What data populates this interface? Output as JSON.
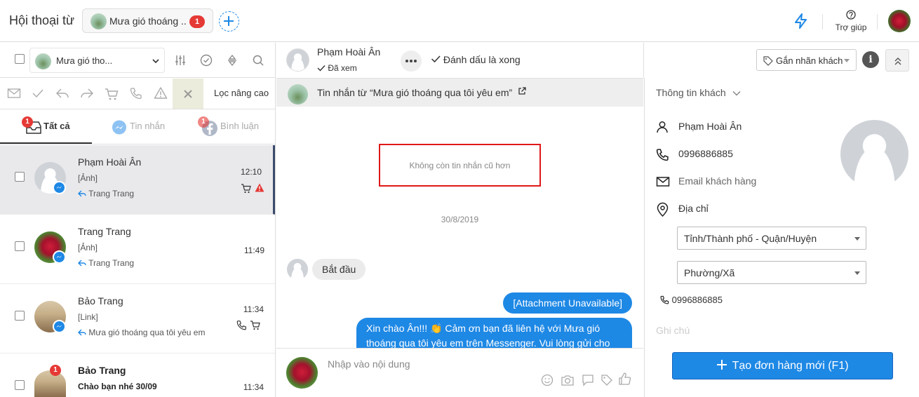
{
  "header": {
    "title": "Hội thoại từ",
    "page_chip_name": "Mưa gió thoáng ..",
    "page_chip_badge": "1",
    "help_label": "Trợ giúp"
  },
  "left_panel": {
    "page_select_name": "Mưa gió tho...",
    "advanced_filter_label": "Lọc nâng cao",
    "tabs": [
      {
        "label": "Tất cả",
        "badge": "1"
      },
      {
        "label": "Tin nhắn"
      },
      {
        "label": "Bình luận",
        "badge": "1"
      }
    ],
    "conversations": [
      {
        "name": "Phạm Hoài Ân",
        "preview": "[Ảnh]",
        "reply": "Trang Trang",
        "time": "12:10"
      },
      {
        "name": "Trang Trang",
        "preview": "[Ảnh]",
        "reply": "Trang Trang",
        "time": "11:49"
      },
      {
        "name": "Bảo Trang",
        "preview": "[Link]",
        "reply": "Mưa gió thoáng qua tôi yêu em",
        "time": "11:34"
      },
      {
        "name": "Bảo Trang",
        "preview": "Chào bạn nhé 30/09",
        "time": "11:34",
        "badge": "1"
      }
    ]
  },
  "chat": {
    "contact_name": "Phạm Hoài Ân",
    "seen_status": "Đã xem",
    "mark_done_label": "Đánh dấu là xong",
    "tag_select_label": "Gắn nhãn khách",
    "source_text": "Tin nhắn từ  “Mưa gió thoáng qua tôi yêu em”",
    "no_older_text": "Không còn tin nhắn cũ hơn",
    "date_separator": "30/8/2019",
    "messages": [
      {
        "dir": "in",
        "text": "Bắt đầu"
      },
      {
        "dir": "out",
        "text": "[Attachment Unavailable]"
      },
      {
        "dir": "out",
        "text": "Xin chào Ân!!! 👏 Cảm ơn bạn đã liên hệ với Mưa gió thoáng qua tôi yêu em trên Messenger. Vui lòng gửi cho"
      }
    ],
    "composer_placeholder": "Nhập vào nội dung"
  },
  "customer": {
    "section_title": "Thông tin khách",
    "name": "Phạm Hoài Ân",
    "phone": "0996886885",
    "email_placeholder": "Email khách hàng",
    "address_label": "Địa chỉ",
    "province_select": "Tỉnh/Thành phố - Quận/Huyện",
    "ward_select": "Phường/Xã",
    "phone_small": "0996886885",
    "faded_section": "Ghi chú",
    "create_order_label": "Tạo đơn hàng mới (F1)"
  },
  "colors": {
    "accent": "#1e88e5",
    "badge": "#e53935",
    "warning": "#e53935",
    "highlight_box": "#e01818"
  }
}
